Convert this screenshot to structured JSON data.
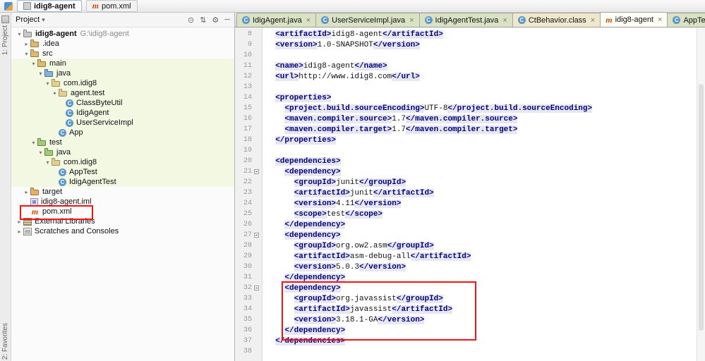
{
  "colors": {
    "tag_color": "#000080",
    "tag_bg": "#e7e7f3",
    "annotation": "#ff1010",
    "row_green": "#f3f8e3",
    "tab_green": "#d9e3c4",
    "tab_cream": "#efe8cc",
    "tab_selected": "#fdfdf6",
    "maven_orange": "#d2500a",
    "class_blue": "#5a96c8",
    "gutter_bg": "#f0f0f0",
    "line_number": "#999999"
  },
  "glyphs": {
    "close": "×",
    "caret": "▾",
    "arrow_down": "▾",
    "arrow_right": "▸",
    "class_letter": "C",
    "maven_letter": "m"
  },
  "title_bar": {
    "project_label": "idig8-agent",
    "file_label": "pom.xml"
  },
  "left_stripe": {
    "top_label": "1: Project",
    "bottom_label": "2: Favorites"
  },
  "project_panel": {
    "header": {
      "title": "Project",
      "icons": [
        {
          "name": "locate-icon",
          "glyph": "⊙"
        },
        {
          "name": "collapse-all-icon",
          "glyph": "⇅"
        },
        {
          "name": "settings-icon",
          "glyph": "⚙"
        },
        {
          "name": "hide-icon",
          "glyph": "─"
        }
      ]
    },
    "items": [
      {
        "indent": 0,
        "arrow": "down",
        "icon": "project",
        "label": "idig8-agent",
        "suffix": "G:\\idig8-agent",
        "bold": true
      },
      {
        "indent": 1,
        "arrow": "right",
        "icon": "folder",
        "label": ".idea"
      },
      {
        "indent": 1,
        "arrow": "down",
        "icon": "folder",
        "label": "src"
      },
      {
        "indent": 2,
        "arrow": "down",
        "icon": "folder",
        "label": "main",
        "bg": "green"
      },
      {
        "indent": 3,
        "arrow": "down",
        "icon": "folder-blue",
        "label": "java",
        "bg": "green"
      },
      {
        "indent": 4,
        "arrow": "down",
        "icon": "package",
        "label": "com.idig8",
        "bg": "green"
      },
      {
        "indent": 5,
        "arrow": "down",
        "icon": "package",
        "label": "agent.test",
        "bg": "green"
      },
      {
        "indent": 6,
        "arrow": "none",
        "icon": "class",
        "label": "ClassByteUtil",
        "bg": "green"
      },
      {
        "indent": 6,
        "arrow": "none",
        "icon": "class",
        "label": "IdigAgent",
        "bg": "green"
      },
      {
        "indent": 6,
        "arrow": "none",
        "icon": "class",
        "label": "UserServiceImpl",
        "bg": "green"
      },
      {
        "indent": 5,
        "arrow": "none",
        "icon": "class",
        "label": "App",
        "bg": "green"
      },
      {
        "indent": 2,
        "arrow": "down",
        "icon": "folder-green",
        "label": "test",
        "bg": "green"
      },
      {
        "indent": 3,
        "arrow": "down",
        "icon": "folder-green",
        "label": "java",
        "bg": "green"
      },
      {
        "indent": 4,
        "arrow": "down",
        "icon": "package",
        "label": "com.idig8",
        "bg": "green"
      },
      {
        "indent": 5,
        "arrow": "none",
        "icon": "class",
        "label": "AppTest",
        "bg": "green"
      },
      {
        "indent": 5,
        "arrow": "none",
        "icon": "class",
        "label": "IdigAgentTest",
        "bg": "green"
      },
      {
        "indent": 1,
        "arrow": "right",
        "icon": "folder-orange",
        "label": "target"
      },
      {
        "indent": 1,
        "arrow": "none",
        "icon": "iml",
        "label": "idig8-agent.iml"
      },
      {
        "indent": 1,
        "arrow": "none",
        "icon": "maven",
        "label": "pom.xml"
      },
      {
        "indent": 0,
        "arrow": "right",
        "icon": "lib",
        "label": "External Libraries"
      },
      {
        "indent": 0,
        "arrow": "right",
        "icon": "scratch",
        "label": "Scratches and Consoles"
      }
    ]
  },
  "editor": {
    "tabs": [
      {
        "icon": "class",
        "label": "IdigAgent.java",
        "bg": "green"
      },
      {
        "icon": "class",
        "label": "UserServiceImpl.java",
        "bg": "green"
      },
      {
        "icon": "class",
        "label": "IdigAgentTest.java",
        "bg": "green"
      },
      {
        "icon": "class",
        "label": "CtBehavior.class",
        "bg": "cream"
      },
      {
        "icon": "maven",
        "label": "idig8-agent",
        "bg": "white",
        "selected": true
      },
      {
        "icon": "class",
        "label": "AppTest.java",
        "bg": "green"
      }
    ],
    "gutter_start": 8,
    "fold_lines": [
      21,
      27,
      32
    ],
    "lines": [
      "  <artifactId>idig8-agent</artifactId>",
      "  <version>1.0-SNAPSHOT</version>",
      "",
      "  <name>idig8-agent</name>",
      "  <url>http://www.idig8.com</url>",
      "",
      "  <properties>",
      "    <project.build.sourceEncoding>UTF-8</project.build.sourceEncoding>",
      "    <maven.compiler.source>1.7</maven.compiler.source>",
      "    <maven.compiler.target>1.7</maven.compiler.target>",
      "  </properties>",
      "",
      "  <dependencies>",
      "    <dependency>",
      "      <groupId>junit</groupId>",
      "      <artifactId>junit</artifactId>",
      "      <version>4.11</version>",
      "      <scope>test</scope>",
      "    </dependency>",
      "    <dependency>",
      "      <groupId>org.ow2.asm</groupId>",
      "      <artifactId>asm-debug-all</artifactId>",
      "      <version>5.0.3</version>",
      "    </dependency>",
      "    <dependency>",
      "      <groupId>org.javassist</groupId>",
      "      <artifactId>javassist</artifactId>",
      "      <version>3.18.1-GA</version>",
      "    </dependency>",
      "  </dependencies>",
      ""
    ]
  }
}
